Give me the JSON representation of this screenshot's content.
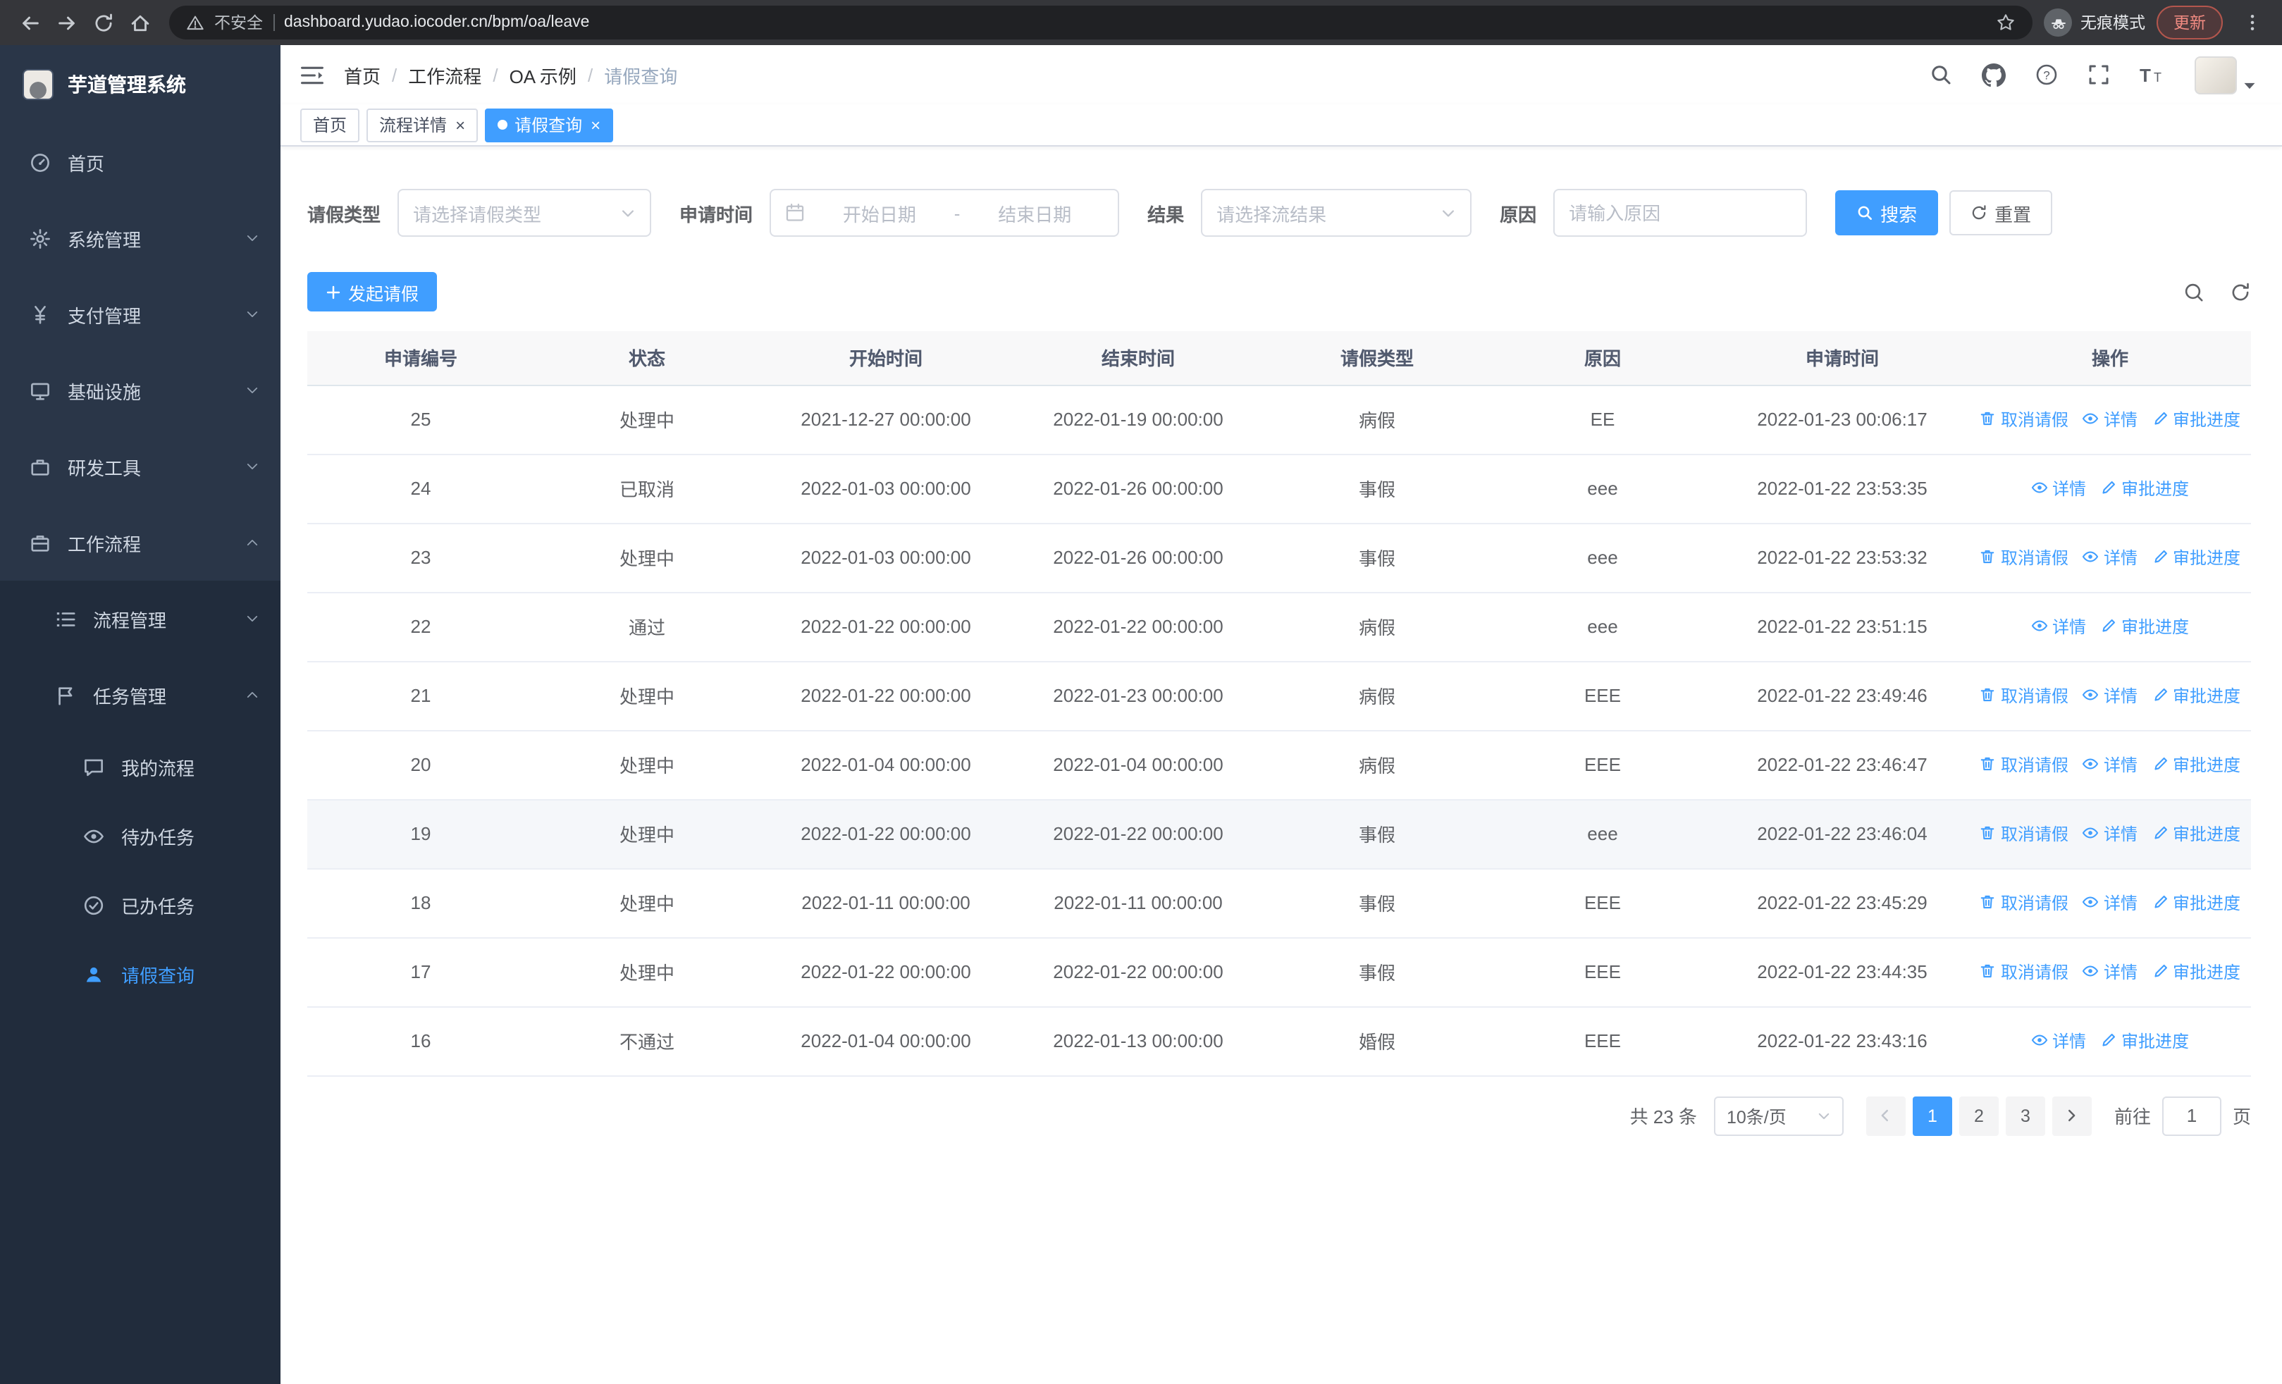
{
  "browser": {
    "security_label": "不安全",
    "url": "dashboard.yudao.iocoder.cn/bpm/oa/leave",
    "incognito_label": "无痕模式",
    "update_label": "更新"
  },
  "sidebar": {
    "logo_title": "芋道管理系统",
    "items": [
      {
        "key": "home",
        "label": "首页",
        "icon": "dashboard",
        "level": 0
      },
      {
        "key": "system-management",
        "label": "系统管理",
        "icon": "gear",
        "level": 0,
        "chevron": "down"
      },
      {
        "key": "payment-management",
        "label": "支付管理",
        "icon": "money",
        "level": 0,
        "chevron": "down"
      },
      {
        "key": "infrastructure",
        "label": "基础设施",
        "icon": "infra",
        "level": 0,
        "chevron": "down"
      },
      {
        "key": "dev-tools",
        "label": "研发工具",
        "icon": "tools",
        "level": 0,
        "chevron": "down"
      },
      {
        "key": "workflow",
        "label": "工作流程",
        "icon": "workflow",
        "level": 0,
        "chevron": "up"
      },
      {
        "key": "process-management",
        "label": "流程管理",
        "icon": "process",
        "level": 1,
        "chevron": "down",
        "sub": true
      },
      {
        "key": "task-management",
        "label": "任务管理",
        "icon": "task",
        "level": 1,
        "chevron": "up",
        "sub": true
      },
      {
        "key": "my-process",
        "label": "我的流程",
        "icon": "chat",
        "level": 2,
        "sub": true
      },
      {
        "key": "todo-tasks",
        "label": "待办任务",
        "icon": "eye",
        "level": 2,
        "sub": true
      },
      {
        "key": "done-tasks",
        "label": "已办任务",
        "icon": "check",
        "level": 2,
        "sub": true
      },
      {
        "key": "leave-query",
        "label": "请假查询",
        "icon": "user",
        "level": 2,
        "sub": true,
        "active": true
      }
    ]
  },
  "header": {
    "breadcrumbs": [
      "首页",
      "工作流程",
      "OA 示例",
      "请假查询"
    ]
  },
  "tabs": [
    {
      "key": "home",
      "label": "首页",
      "closable": false,
      "active": false
    },
    {
      "key": "process-detail",
      "label": "流程详情",
      "closable": true,
      "active": false
    },
    {
      "key": "leave-query",
      "label": "请假查询",
      "closable": true,
      "active": true
    }
  ],
  "filters": {
    "leave_type_label": "请假类型",
    "leave_type_placeholder": "请选择请假类型",
    "apply_time_label": "申请时间",
    "start_date_placeholder": "开始日期",
    "range_separator": "-",
    "end_date_placeholder": "结束日期",
    "result_label": "结果",
    "result_placeholder": "请选择流结果",
    "reason_label": "原因",
    "reason_placeholder": "请输入原因",
    "search_label": "搜索",
    "reset_label": "重置"
  },
  "toolbar": {
    "create_label": "发起请假"
  },
  "table": {
    "columns": [
      "申请编号",
      "状态",
      "开始时间",
      "结束时间",
      "请假类型",
      "原因",
      "申请时间",
      "操作"
    ],
    "column_keys": [
      "id",
      "status",
      "start",
      "end",
      "type",
      "reason",
      "applied"
    ],
    "action_labels": {
      "cancel": "取消请假",
      "detail": "详情",
      "progress": "审批进度"
    },
    "rows": [
      {
        "id": "25",
        "status": "处理中",
        "start": "2021-12-27 00:00:00",
        "end": "2022-01-19 00:00:00",
        "type": "病假",
        "reason": "EE",
        "applied": "2022-01-23 00:06:17",
        "actions": [
          "cancel",
          "detail",
          "progress"
        ]
      },
      {
        "id": "24",
        "status": "已取消",
        "start": "2022-01-03 00:00:00",
        "end": "2022-01-26 00:00:00",
        "type": "事假",
        "reason": "eee",
        "applied": "2022-01-22 23:53:35",
        "actions": [
          "detail",
          "progress"
        ]
      },
      {
        "id": "23",
        "status": "处理中",
        "start": "2022-01-03 00:00:00",
        "end": "2022-01-26 00:00:00",
        "type": "事假",
        "reason": "eee",
        "applied": "2022-01-22 23:53:32",
        "actions": [
          "cancel",
          "detail",
          "progress"
        ]
      },
      {
        "id": "22",
        "status": "通过",
        "start": "2022-01-22 00:00:00",
        "end": "2022-01-22 00:00:00",
        "type": "病假",
        "reason": "eee",
        "applied": "2022-01-22 23:51:15",
        "actions": [
          "detail",
          "progress"
        ]
      },
      {
        "id": "21",
        "status": "处理中",
        "start": "2022-01-22 00:00:00",
        "end": "2022-01-23 00:00:00",
        "type": "病假",
        "reason": "EEE",
        "applied": "2022-01-22 23:49:46",
        "actions": [
          "cancel",
          "detail",
          "progress"
        ]
      },
      {
        "id": "20",
        "status": "处理中",
        "start": "2022-01-04 00:00:00",
        "end": "2022-01-04 00:00:00",
        "type": "病假",
        "reason": "EEE",
        "applied": "2022-01-22 23:46:47",
        "actions": [
          "cancel",
          "detail",
          "progress"
        ]
      },
      {
        "id": "19",
        "status": "处理中",
        "start": "2022-01-22 00:00:00",
        "end": "2022-01-22 00:00:00",
        "type": "事假",
        "reason": "eee",
        "applied": "2022-01-22 23:46:04",
        "actions": [
          "cancel",
          "detail",
          "progress"
        ],
        "hovered": true
      },
      {
        "id": "18",
        "status": "处理中",
        "start": "2022-01-11 00:00:00",
        "end": "2022-01-11 00:00:00",
        "type": "事假",
        "reason": "EEE",
        "applied": "2022-01-22 23:45:29",
        "actions": [
          "cancel",
          "detail",
          "progress"
        ]
      },
      {
        "id": "17",
        "status": "处理中",
        "start": "2022-01-22 00:00:00",
        "end": "2022-01-22 00:00:00",
        "type": "事假",
        "reason": "EEE",
        "applied": "2022-01-22 23:44:35",
        "actions": [
          "cancel",
          "detail",
          "progress"
        ]
      },
      {
        "id": "16",
        "status": "不通过",
        "start": "2022-01-04 00:00:00",
        "end": "2022-01-13 00:00:00",
        "type": "婚假",
        "reason": "EEE",
        "applied": "2022-01-22 23:43:16",
        "actions": [
          "detail",
          "progress"
        ]
      }
    ]
  },
  "pagination": {
    "total_label": "共 23 条",
    "page_size_label": "10条/页",
    "pages": [
      "1",
      "2",
      "3"
    ],
    "active_page": "1",
    "goto_label": "前往",
    "goto_value": "1",
    "page_unit_label": "页"
  },
  "colors": {
    "accent": "#409eff",
    "sidebar_bg": "#2a3648",
    "sidebar_sub_bg": "#212c3c"
  }
}
